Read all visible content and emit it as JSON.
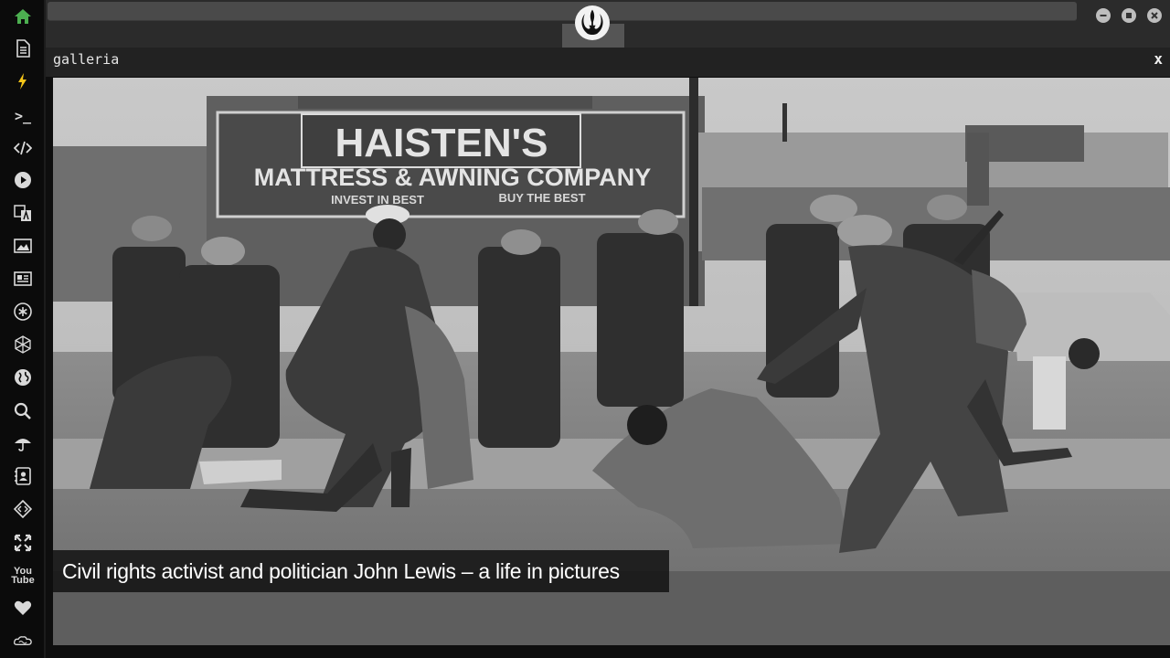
{
  "window": {
    "controls": [
      "minimize",
      "maximize",
      "close"
    ],
    "tab_icon": "rebel-alliance-logo"
  },
  "sidebar": {
    "items": [
      {
        "icon": "home-icon",
        "color": "#4caf50"
      },
      {
        "icon": "document-icon"
      },
      {
        "icon": "lightning-icon",
        "color": "#f5c518"
      },
      {
        "icon": "terminal-icon"
      },
      {
        "icon": "code-icon"
      },
      {
        "icon": "play-icon"
      },
      {
        "icon": "translate-icon"
      },
      {
        "icon": "image-icon"
      },
      {
        "icon": "newspaper-icon"
      },
      {
        "icon": "asterisk-icon"
      },
      {
        "icon": "hexagon-icon"
      },
      {
        "icon": "globe-icon"
      },
      {
        "icon": "search-icon"
      },
      {
        "icon": "umbrella-icon"
      },
      {
        "icon": "contact-icon"
      },
      {
        "icon": "embed-icon"
      },
      {
        "icon": "expand-icon"
      },
      {
        "icon": "youtube-icon"
      },
      {
        "icon": "heart-icon"
      },
      {
        "icon": "infinity-cloud-icon"
      }
    ],
    "youtube_label": "You\nTube"
  },
  "panel": {
    "title": "galleria",
    "close_label": "x"
  },
  "gallery": {
    "caption": "Civil rights activist and politician John Lewis – a life in pictures",
    "photo_sign_line1": "HAISTEN'S",
    "photo_sign_line2": "MATTRESS & AWNING COMPANY",
    "photo_sign_line3": "INVEST IN BEST",
    "photo_sign_line4": "BUY THE BEST"
  }
}
